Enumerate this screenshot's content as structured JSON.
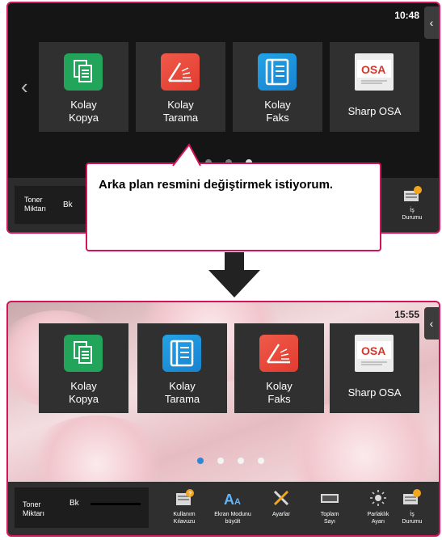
{
  "top_screen": {
    "clock": "10:48",
    "tiles": [
      {
        "label": "Kolay\nKopya",
        "icon": "copy-icon"
      },
      {
        "label": "Kolay\nTarama",
        "icon": "scan-icon"
      },
      {
        "label": "Kolay\nFaks",
        "icon": "fax-icon"
      },
      {
        "label": "Sharp OSA",
        "icon": "osa-icon"
      }
    ],
    "page_count": 4,
    "active_page": 4,
    "toner_label": "Toner\nMiktarı",
    "bk_label": "Bk",
    "job_status_label": "İş\nDurumu"
  },
  "callout": {
    "text": "Arka plan resmini değiştirmek istiyorum."
  },
  "bottom_screen": {
    "clock": "15:55",
    "tiles": [
      {
        "label": "Kolay\nKopya",
        "icon": "copy-icon"
      },
      {
        "label": "Kolay\nTarama",
        "icon": "fax-icon"
      },
      {
        "label": "Kolay\nFaks",
        "icon": "scan-icon"
      },
      {
        "label": "Sharp OSA",
        "icon": "osa-icon"
      }
    ],
    "page_count": 4,
    "active_page": 1,
    "toner_label": "Toner\nMiktarı",
    "bk_label": "Bk",
    "bar_items": [
      {
        "label": "Kullanım\nKılavuzu",
        "icon": "manual-icon"
      },
      {
        "label": "Ekran Modunu\nbüyült",
        "icon": "enlarge-display-icon"
      },
      {
        "label": "Ayarlar",
        "icon": "settings-icon"
      },
      {
        "label": "Toplam\nSayı",
        "icon": "total-count-icon"
      },
      {
        "label": "Parlaklık\nAyarı",
        "icon": "brightness-icon"
      },
      {
        "label": "İş\nDurumu",
        "icon": "job-status-icon"
      }
    ]
  },
  "colors": {
    "highlight": "#d4145a",
    "dark_bg": "#151515",
    "tile_bg": "#303030",
    "active_dot_bottom": "#2d86d6"
  }
}
